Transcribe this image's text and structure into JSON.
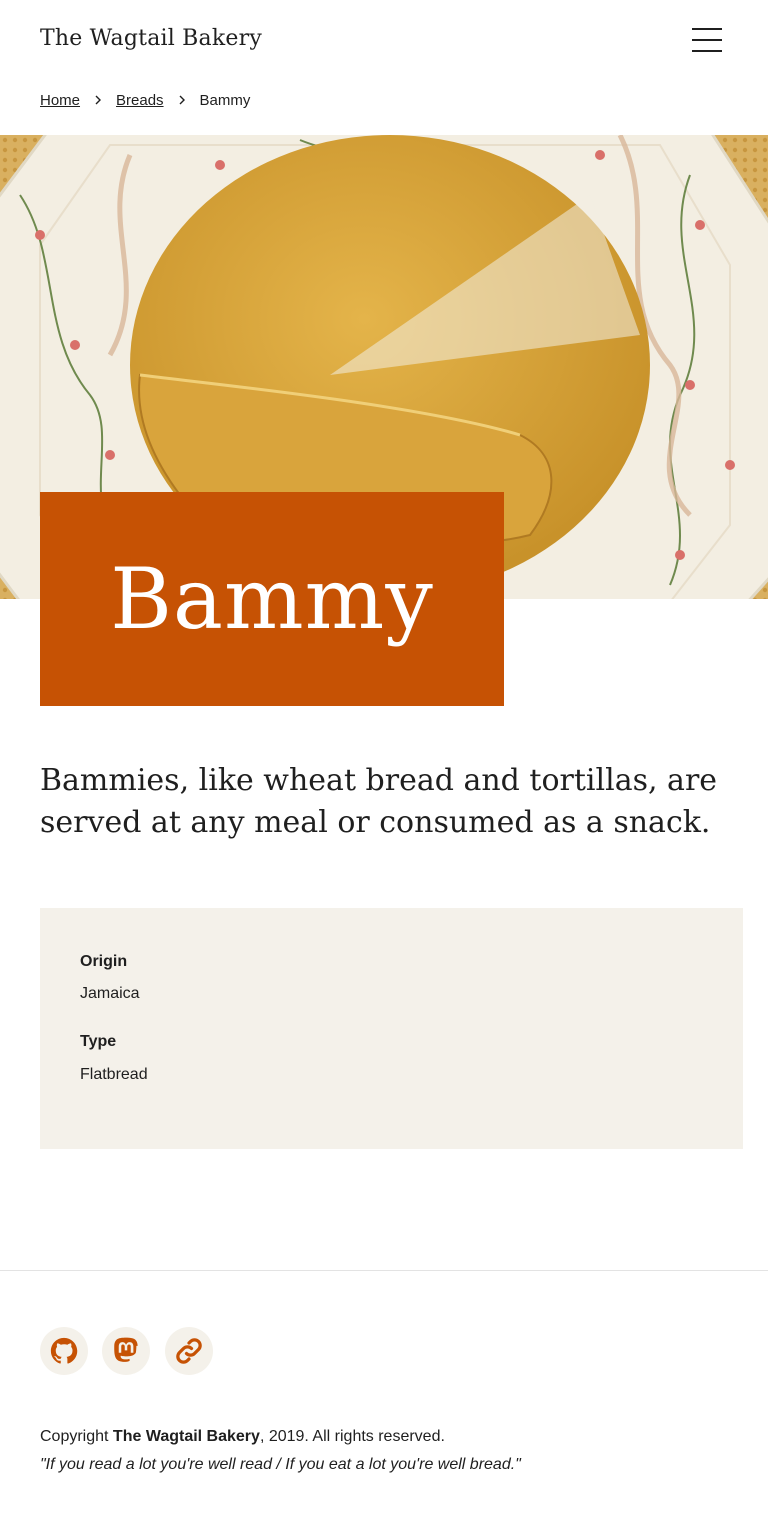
{
  "header": {
    "site_title": "The Wagtail Bakery",
    "menu_icon": "hamburger-menu-icon"
  },
  "breadcrumb": {
    "items": [
      {
        "label": "Home",
        "link": true
      },
      {
        "label": "Breads",
        "link": true
      },
      {
        "label": "Bammy",
        "link": false
      }
    ],
    "separator_icon": "chevron-right-icon"
  },
  "hero": {
    "image_subject": "bammy-flatbread-on-plate"
  },
  "page": {
    "title": "Bammy",
    "intro": "Bammies, like wheat bread and tortillas, are served at any meal or consumed as a snack."
  },
  "details": {
    "origin_label": "Origin",
    "origin_value": "Jamaica",
    "type_label": "Type",
    "type_value": "Flatbread"
  },
  "footer": {
    "social_icons": [
      "github-icon",
      "mastodon-icon",
      "link-icon"
    ],
    "copyright_prefix": "Copyright ",
    "copyright_name": "The Wagtail Bakery",
    "copyright_suffix": ", 2019. All rights reserved.",
    "quote": "\"If you read a lot you're well read / If you eat a lot you're well bread.\""
  },
  "colors": {
    "accent": "#c65204",
    "panel_background": "#f4f1ea",
    "text": "#1f1f1f"
  }
}
